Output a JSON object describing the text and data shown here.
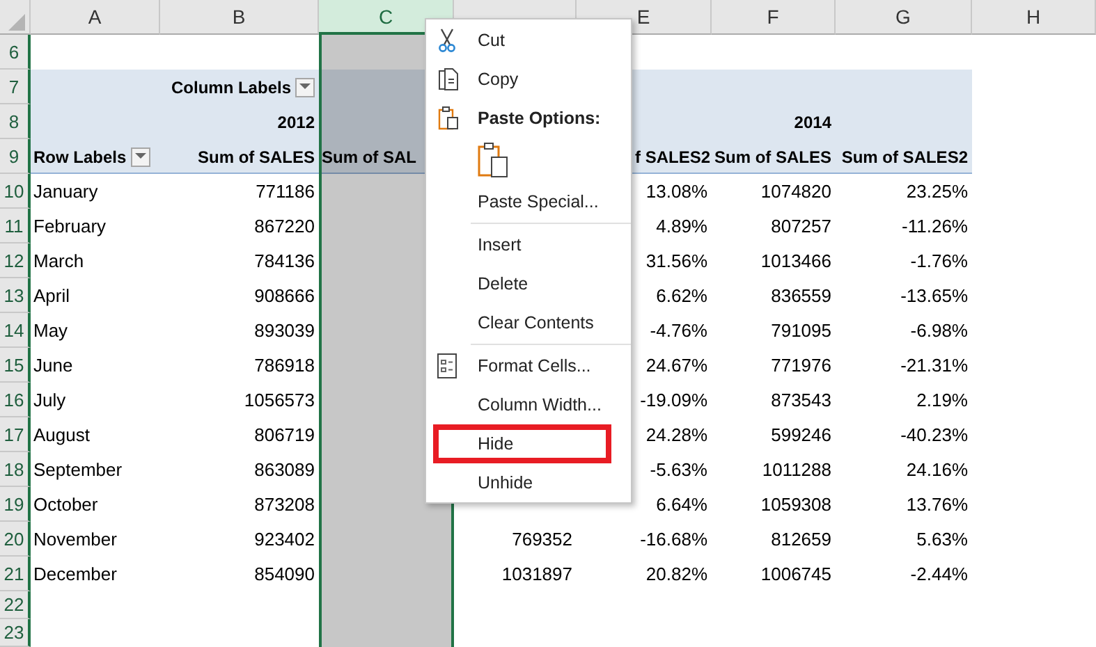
{
  "columns": [
    {
      "letter": "A",
      "selected": false
    },
    {
      "letter": "B",
      "selected": false
    },
    {
      "letter": "C",
      "selected": true
    },
    {
      "selected": false
    },
    {
      "letter": "E",
      "selected": false
    },
    {
      "letter": "F",
      "selected": false
    },
    {
      "letter": "G",
      "selected": false
    },
    {
      "letter": "H",
      "selected": false
    }
  ],
  "rows": [
    {
      "number": "6",
      "kind": "blank",
      "cells": {}
    },
    {
      "number": "7",
      "kind": "pivot-header",
      "cells": {
        "B": {
          "text": "Column Labels",
          "dropdown": true
        }
      }
    },
    {
      "number": "8",
      "kind": "pivot-header",
      "cells": {
        "B": {
          "text": "2012"
        },
        "F": {
          "text": "2014"
        }
      }
    },
    {
      "number": "9",
      "kind": "pivot-header",
      "cells": {
        "A": {
          "text": "Row Labels",
          "dropdown": true
        },
        "B": {
          "text": "Sum of SALES"
        },
        "C": {
          "text": "Sum of SAL"
        },
        "E": {
          "text": "f SALES2"
        },
        "F": {
          "text": "Sum of SALES"
        },
        "G": {
          "text": "Sum of SALES2"
        }
      }
    },
    {
      "number": "10",
      "kind": "data",
      "cells": {
        "A": {
          "text": "January"
        },
        "B": {
          "text": "771186"
        },
        "E": {
          "text": "13.08%"
        },
        "F": {
          "text": "1074820"
        },
        "G": {
          "text": "23.25%"
        }
      }
    },
    {
      "number": "11",
      "kind": "data",
      "cells": {
        "A": {
          "text": "February"
        },
        "B": {
          "text": "867220"
        },
        "E": {
          "text": "4.89%"
        },
        "F": {
          "text": "807257"
        },
        "G": {
          "text": "-11.26%"
        }
      }
    },
    {
      "number": "12",
      "kind": "data",
      "cells": {
        "A": {
          "text": "March"
        },
        "B": {
          "text": "784136"
        },
        "E": {
          "text": "31.56%"
        },
        "F": {
          "text": "1013466"
        },
        "G": {
          "text": "-1.76%"
        }
      }
    },
    {
      "number": "13",
      "kind": "data",
      "cells": {
        "A": {
          "text": "April"
        },
        "B": {
          "text": "908666"
        },
        "E": {
          "text": "6.62%"
        },
        "F": {
          "text": "836559"
        },
        "G": {
          "text": "-13.65%"
        }
      }
    },
    {
      "number": "14",
      "kind": "data",
      "cells": {
        "A": {
          "text": "May"
        },
        "B": {
          "text": "893039"
        },
        "E": {
          "text": "-4.76%"
        },
        "F": {
          "text": "791095"
        },
        "G": {
          "text": "-6.98%"
        }
      }
    },
    {
      "number": "15",
      "kind": "data",
      "cells": {
        "A": {
          "text": "June"
        },
        "B": {
          "text": "786918"
        },
        "E": {
          "text": "24.67%"
        },
        "F": {
          "text": "771976"
        },
        "G": {
          "text": "-21.31%"
        }
      }
    },
    {
      "number": "16",
      "kind": "data",
      "cells": {
        "A": {
          "text": "July"
        },
        "B": {
          "text": "1056573"
        },
        "E": {
          "text": "-19.09%"
        },
        "F": {
          "text": "873543"
        },
        "G": {
          "text": "2.19%"
        }
      }
    },
    {
      "number": "17",
      "kind": "data",
      "cells": {
        "A": {
          "text": "August"
        },
        "B": {
          "text": "806719"
        },
        "E": {
          "text": "24.28%"
        },
        "F": {
          "text": "599246"
        },
        "G": {
          "text": "-40.23%"
        }
      }
    },
    {
      "number": "18",
      "kind": "data",
      "cells": {
        "A": {
          "text": "September"
        },
        "B": {
          "text": "863089"
        },
        "E": {
          "text": "-5.63%"
        },
        "F": {
          "text": "1011288"
        },
        "G": {
          "text": "24.16%"
        }
      }
    },
    {
      "number": "19",
      "kind": "data",
      "cells": {
        "A": {
          "text": "October"
        },
        "B": {
          "text": "873208"
        },
        "E": {
          "text": "6.64%"
        },
        "F": {
          "text": "1059308"
        },
        "G": {
          "text": "13.76%"
        }
      }
    },
    {
      "number": "20",
      "kind": "data",
      "cells": {
        "A": {
          "text": "November"
        },
        "B": {
          "text": "923402"
        },
        "D": {
          "text": "769352"
        },
        "E": {
          "text": "-16.68%"
        },
        "F": {
          "text": "812659"
        },
        "G": {
          "text": "5.63%"
        }
      }
    },
    {
      "number": "21",
      "kind": "data",
      "cells": {
        "A": {
          "text": "December"
        },
        "B": {
          "text": "854090"
        },
        "D": {
          "text": "1031897"
        },
        "E": {
          "text": "20.82%"
        },
        "F": {
          "text": "1006745"
        },
        "G": {
          "text": "-2.44%"
        }
      }
    },
    {
      "number": "22",
      "kind": "blank",
      "cells": {}
    },
    {
      "number": "23",
      "kind": "blank",
      "cells": {}
    }
  ],
  "context_menu": {
    "items": [
      {
        "kind": "cut",
        "label": "Cut",
        "outlined": false
      },
      {
        "kind": "copy",
        "label": "Copy",
        "outlined": false
      },
      {
        "kind": "paste-heading",
        "label": "Paste Options:"
      },
      {
        "kind": "paste-button"
      },
      {
        "kind": "command",
        "label": "Paste Special...",
        "outlined": false
      },
      {
        "kind": "separator"
      },
      {
        "kind": "command",
        "label": "Insert",
        "outlined": false
      },
      {
        "kind": "command",
        "label": "Delete",
        "outlined": false
      },
      {
        "kind": "command",
        "label": "Clear Contents",
        "outlined": false
      },
      {
        "kind": "separator"
      },
      {
        "kind": "format",
        "label": "Format Cells...",
        "outlined": false
      },
      {
        "kind": "command",
        "label": "Column Width...",
        "outlined": false
      },
      {
        "kind": "command",
        "label": "Hide",
        "outlined": true
      },
      {
        "kind": "command",
        "label": "Unhide",
        "outlined": false
      }
    ]
  }
}
